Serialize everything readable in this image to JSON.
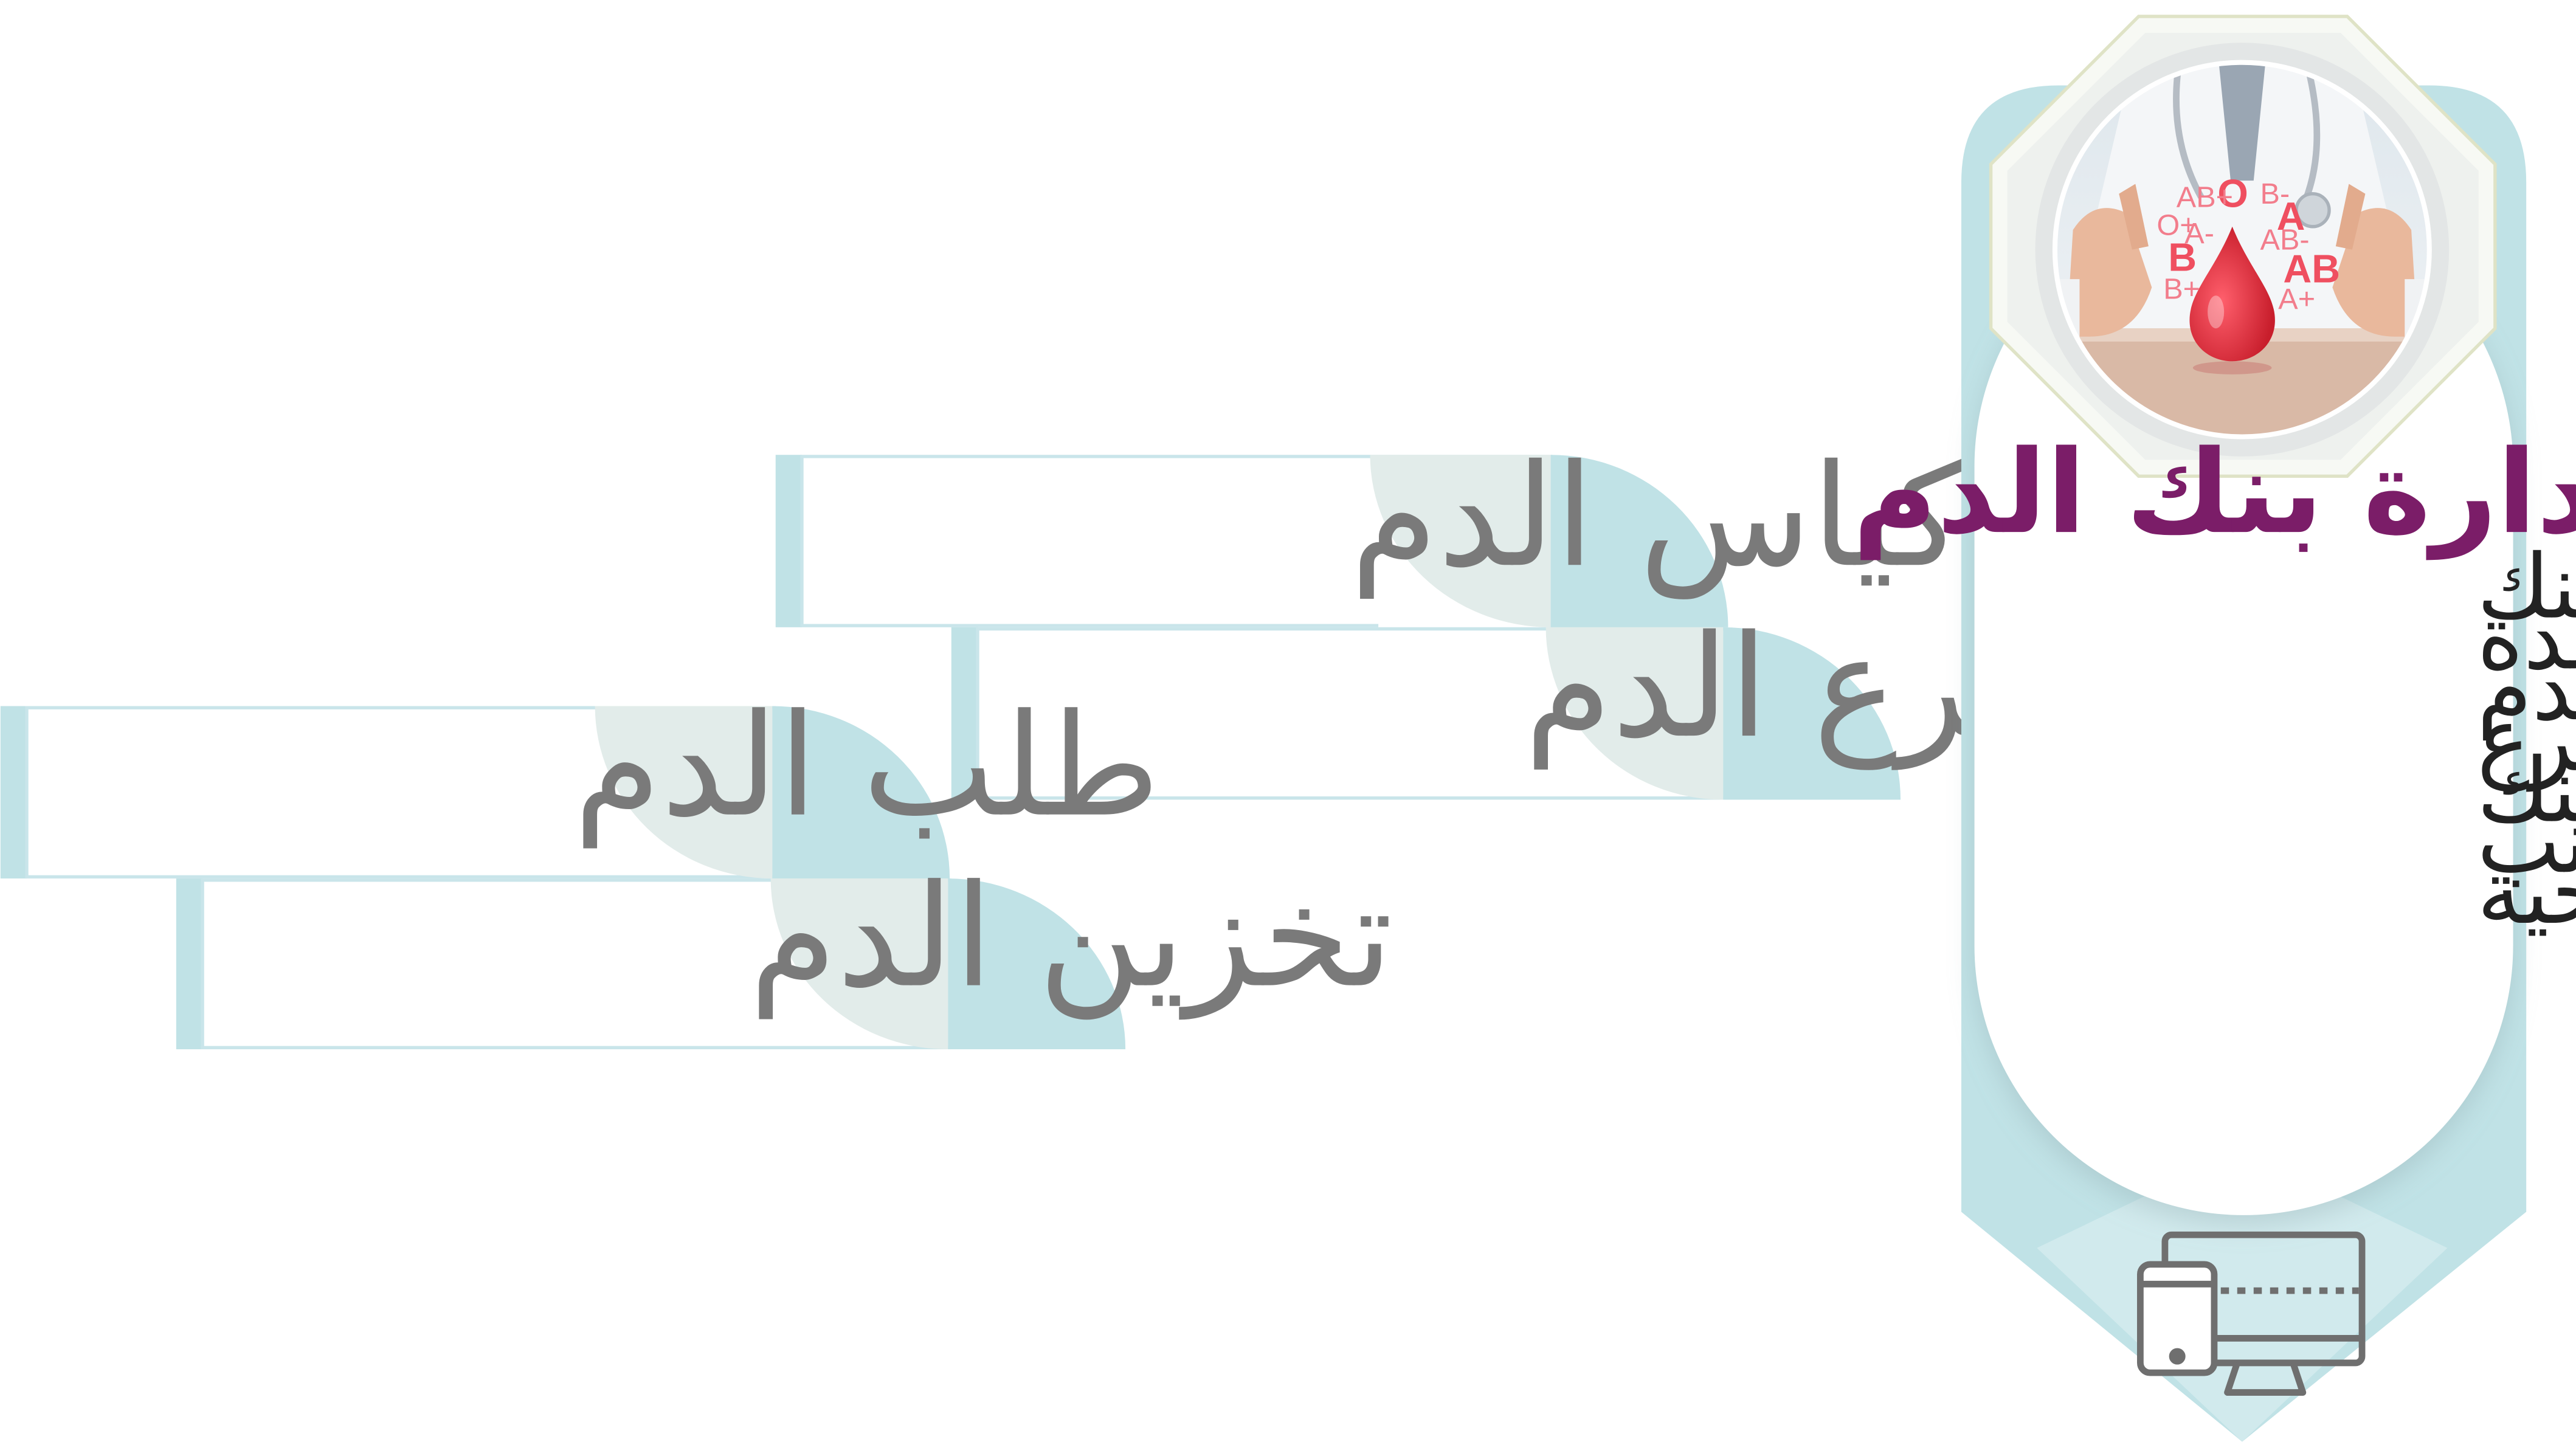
{
  "features": [
    {
      "label": "إدارة أكياس الدم"
    },
    {
      "label": "التبرع الدم"
    },
    {
      "label": "طلب الدم"
    },
    {
      "label": "تخزين الدم"
    }
  ],
  "panel": {
    "title": "إدارة بنك الدم",
    "description_lines": [
      "يتيح النظام إدارة عمليات بنك",
      "الدم بكفاءة. تتضمن الوحدة",
      "إدارة أكياس الدم ، وطلب الدم",
      "وإصداره ، وتخزين الدم ، والتبرع",
      "بالدم للمرضى. تعد إدارة بنك",
      "الدم جانبًا مهمًا من جوانب",
      "الرعاية الصحية"
    ],
    "image": {
      "blood_types": [
        "O",
        "A",
        "B",
        "AB",
        "AB+",
        "O+",
        "A-",
        "AB-",
        "B+",
        "A+",
        "B-"
      ]
    },
    "icons": [
      "blood-drop-icon",
      "devices-icon"
    ]
  },
  "colors": {
    "teal": "#c0e2e6",
    "sage": "#e2ecea",
    "card_border": "#c9e5ea",
    "title_purple": "#7b1d68",
    "label_gray": "#7a7a7a",
    "drop_red": "#e8303f",
    "icon_gray": "#6f6f6f"
  }
}
